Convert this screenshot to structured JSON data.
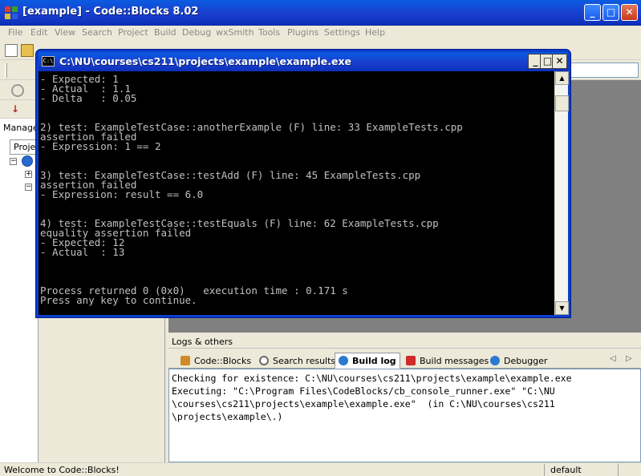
{
  "main_window": {
    "title": "[example] - Code::Blocks 8.02",
    "controls": {
      "minimize": "_",
      "maximize": "□",
      "close": "✕"
    }
  },
  "menu": [
    "File",
    "Edit",
    "View",
    "Search",
    "Project",
    "Build",
    "Debug",
    "wxSmith",
    "Tools",
    "Plugins",
    "Settings",
    "Help"
  ],
  "management": {
    "title": "Manage",
    "tab": "Proje"
  },
  "console": {
    "title": "C:\\NU\\courses\\cs211\\projects\\example\\example.exe",
    "icon_label": "C:\\",
    "controls": {
      "minimize": "_",
      "maximize": "□",
      "close": "✕"
    },
    "output": "- Expected: 1\n- Actual  : 1.1\n- Delta   : 0.05\n\n\n2) test: ExampleTestCase::anotherExample (F) line: 33 ExampleTests.cpp\nassertion failed\n- Expression: 1 == 2\n\n\n3) test: ExampleTestCase::testAdd (F) line: 45 ExampleTests.cpp\nassertion failed\n- Expression: result == 6.0\n\n\n4) test: ExampleTestCase::testEquals (F) line: 62 ExampleTests.cpp\nequality assertion failed\n- Expected: 12\n- Actual  : 13\n\n\n\nProcess returned 0 (0x0)   execution time : 0.171 s\nPress any key to continue."
  },
  "logs": {
    "title": "Logs & others",
    "tabs": [
      {
        "label": "Code::Blocks",
        "icon": "notepad-icon",
        "color": "#d08a2a"
      },
      {
        "label": "Search results",
        "icon": "search-icon",
        "color": "#6a6a6a"
      },
      {
        "label": "Build log",
        "icon": "gear-icon",
        "color": "#2a7ad0",
        "active": true
      },
      {
        "label": "Build messages",
        "icon": "flag-icon",
        "color": "#d02a2a"
      },
      {
        "label": "Debugger",
        "icon": "gear-icon",
        "color": "#2a7ad0"
      }
    ],
    "nav": {
      "prev": "◁",
      "next": "▷"
    },
    "content": "Checking for existence: C:\\NU\\courses\\cs211\\projects\\example\\example.exe\nExecuting: \"C:\\Program Files\\CodeBlocks/cb_console_runner.exe\" \"C:\\NU\n\\courses\\cs211\\projects\\example\\example.exe\"  (in C:\\NU\\courses\\cs211\n\\projects\\example\\.)"
  },
  "statusbar": {
    "message": "Welcome to Code::Blocks!",
    "mode": "default"
  }
}
